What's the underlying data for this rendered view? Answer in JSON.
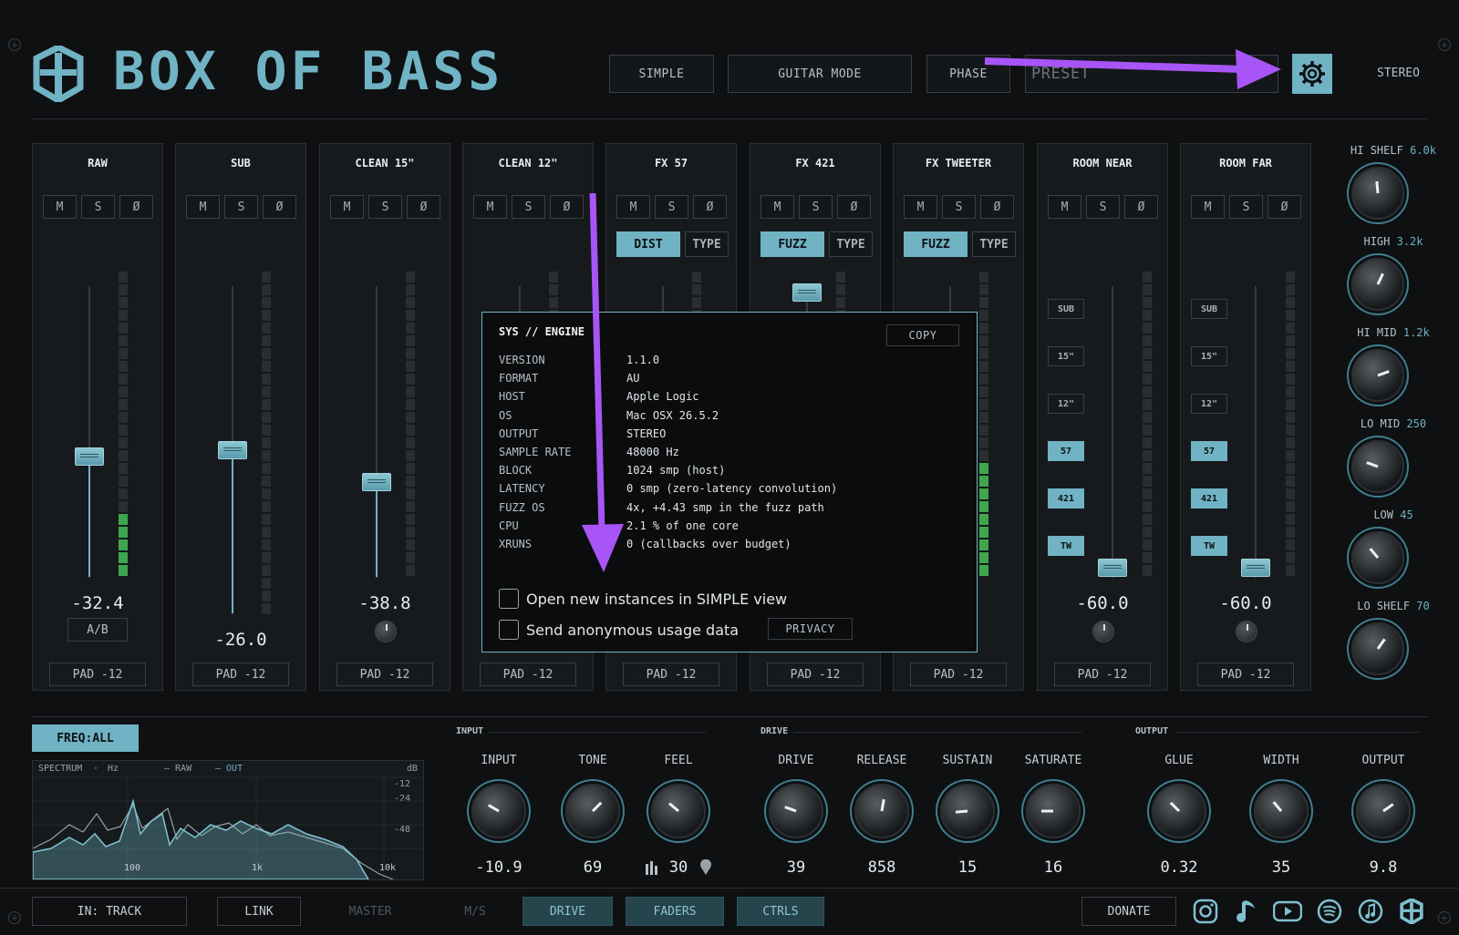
{
  "header": {
    "title": "BOX OF BASS",
    "simple": "SIMPLE",
    "guitar_mode": "GUITAR MODE",
    "phase": "PHASE",
    "preset_placeholder": "PRESET",
    "stereo": "STEREO"
  },
  "strips": [
    {
      "name": "RAW",
      "m": "M",
      "s": "S",
      "phase": "Ø",
      "value": "-32.4",
      "ab": "A/B",
      "pad": "PAD -12"
    },
    {
      "name": "SUB",
      "m": "M",
      "s": "S",
      "phase": "Ø",
      "value": "-26.0",
      "pad": "PAD -12"
    },
    {
      "name": "CLEAN 15\"",
      "m": "M",
      "s": "S",
      "phase": "Ø",
      "value": "-38.8",
      "pad": "PAD -12"
    },
    {
      "name": "CLEAN 12\"",
      "m": "M",
      "s": "S",
      "phase": "Ø",
      "pad": "PAD -12"
    },
    {
      "name": "FX 57",
      "m": "M",
      "s": "S",
      "phase": "Ø",
      "mode": "DIST",
      "type": "TYPE",
      "pad": "PAD -12"
    },
    {
      "name": "FX 421",
      "m": "M",
      "s": "S",
      "phase": "Ø",
      "mode": "FUZZ",
      "type": "TYPE",
      "pad": "PAD -12"
    },
    {
      "name": "FX TWEETER",
      "m": "M",
      "s": "S",
      "phase": "Ø",
      "mode": "FUZZ",
      "type": "TYPE",
      "pad": "PAD -12"
    },
    {
      "name": "ROOM NEAR",
      "m": "M",
      "s": "S",
      "phase": "Ø",
      "value": "-60.0",
      "pad": "PAD -12",
      "routes": [
        "SUB",
        "15\"",
        "12\"",
        "57",
        "421",
        "TW"
      ]
    },
    {
      "name": "ROOM FAR",
      "m": "M",
      "s": "S",
      "phase": "Ø",
      "value": "-60.0",
      "pad": "PAD -12",
      "routes": [
        "SUB",
        "15\"",
        "12\"",
        "57",
        "421",
        "TW"
      ]
    }
  ],
  "eq": [
    {
      "label": "HI SHELF",
      "freq": "6.0k"
    },
    {
      "label": "HIGH",
      "freq": "3.2k"
    },
    {
      "label": "HI MID",
      "freq": "1.2k"
    },
    {
      "label": "LO MID",
      "freq": "250"
    },
    {
      "label": "LOW",
      "freq": "45"
    },
    {
      "label": "LO SHELF",
      "freq": "70"
    }
  ],
  "dialog": {
    "title": "SYS // ENGINE",
    "copy": "COPY",
    "rows": [
      {
        "k": "VERSION",
        "v": "1.1.0"
      },
      {
        "k": "FORMAT",
        "v": "AU"
      },
      {
        "k": "HOST",
        "v": "Apple Logic"
      },
      {
        "k": "OS",
        "v": "Mac OSX 26.5.2"
      },
      {
        "k": "OUTPUT",
        "v": "STEREO"
      },
      {
        "k": "SAMPLE RATE",
        "v": "48000 Hz"
      },
      {
        "k": "BLOCK",
        "v": "1024 smp (host)"
      },
      {
        "k": "LATENCY",
        "v": "0 smp (zero-latency convolution)"
      },
      {
        "k": "FUZZ OS",
        "v": "4x, +4.43 smp in the fuzz path"
      },
      {
        "k": "CPU",
        "v": "2.1 % of one core"
      },
      {
        "k": "XRUNS",
        "v": "0 (callbacks over budget)"
      }
    ],
    "check1": "Open new instances in SIMPLE view",
    "check2": "Send anonymous usage data",
    "privacy": "PRIVACY"
  },
  "spectrum": {
    "freq_btn": "FREQ:ALL",
    "label": "SPECTRUM",
    "dot": "·",
    "hz": "Hz",
    "raw": "— RAW",
    "out": "— OUT",
    "db": "dB",
    "db_ticks": [
      "-12",
      "-24",
      "-48"
    ],
    "x_ticks": [
      "100",
      "1k",
      "10k"
    ]
  },
  "sections": {
    "input": "INPUT",
    "drive": "DRIVE",
    "output": "OUTPUT"
  },
  "knobs": [
    {
      "label": "INPUT",
      "value": "-10.9"
    },
    {
      "label": "TONE",
      "value": "69"
    },
    {
      "label": "FEEL",
      "value": "30"
    },
    {
      "label": "DRIVE",
      "value": "39"
    },
    {
      "label": "RELEASE",
      "value": "858"
    },
    {
      "label": "SUSTAIN",
      "value": "15"
    },
    {
      "label": "SATURATE",
      "value": "16"
    },
    {
      "label": "GLUE",
      "value": "0.32"
    },
    {
      "label": "WIDTH",
      "value": "35"
    },
    {
      "label": "OUTPUT",
      "value": "9.8"
    }
  ],
  "footer": {
    "in_track": "IN: TRACK",
    "link": "LINK",
    "master": "MASTER",
    "ms": "M/S",
    "drive": "DRIVE",
    "faders": "FADERS",
    "ctrls": "CTRLS",
    "donate": "DONATE"
  },
  "icons": [
    "instagram-icon",
    "music-note-icon",
    "youtube-icon",
    "spotify-icon",
    "apple-music-icon",
    "logo-icon"
  ],
  "colors": {
    "accent": "#6fb3c4",
    "meter_green": "#3fa64f",
    "arrow": "#a855f7",
    "background": "#0e1012"
  }
}
